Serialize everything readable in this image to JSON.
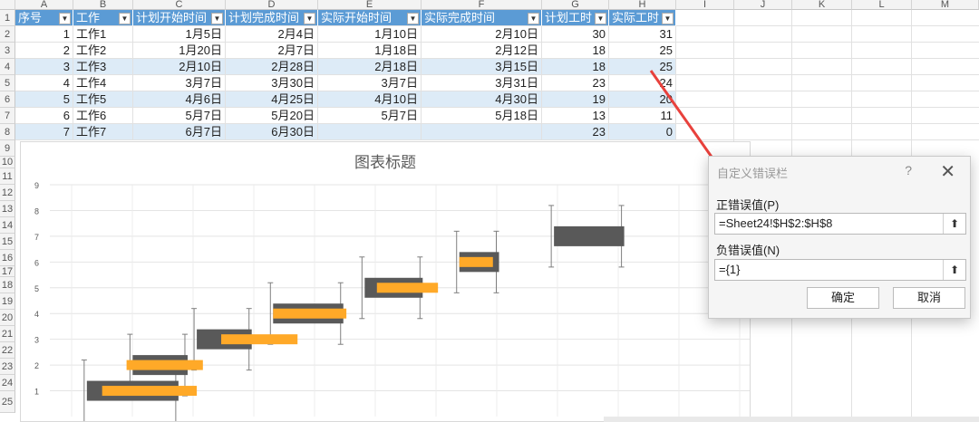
{
  "columns": [
    "A",
    "B",
    "C",
    "D",
    "E",
    "F",
    "G",
    "H",
    "I",
    "J",
    "K",
    "L",
    "M"
  ],
  "rows": [
    "1",
    "2",
    "3",
    "4",
    "5",
    "6",
    "7",
    "8",
    "9",
    "10",
    "11",
    "12",
    "13",
    "14",
    "15",
    "16",
    "17",
    "18",
    "19",
    "20",
    "21",
    "22",
    "23",
    "24",
    "25"
  ],
  "table": {
    "headers": [
      "序号",
      "工作",
      "计划开始时间",
      "计划完成时间",
      "实际开始时间",
      "实际完成时间",
      "计划工时",
      "实际工时"
    ],
    "rows": [
      [
        "1",
        "工作1",
        "1月5日",
        "2月4日",
        "1月10日",
        "2月10日",
        "30",
        "31"
      ],
      [
        "2",
        "工作2",
        "1月20日",
        "2月7日",
        "1月18日",
        "2月12日",
        "18",
        "25"
      ],
      [
        "3",
        "工作3",
        "2月10日",
        "2月28日",
        "2月18日",
        "3月15日",
        "18",
        "25"
      ],
      [
        "4",
        "工作4",
        "3月7日",
        "3月30日",
        "3月7日",
        "3月31日",
        "23",
        "24"
      ],
      [
        "5",
        "工作5",
        "4月6日",
        "4月25日",
        "4月10日",
        "4月30日",
        "19",
        "20"
      ],
      [
        "6",
        "工作6",
        "5月7日",
        "5月20日",
        "5月7日",
        "5月18日",
        "13",
        "11"
      ],
      [
        "7",
        "工作7",
        "6月7日",
        "6月30日",
        "",
        "",
        "23",
        "0"
      ]
    ]
  },
  "chart": {
    "title": "图表标题"
  },
  "chart_data": {
    "type": "bar",
    "title": "图表标题",
    "ylim": [
      0,
      9
    ],
    "yticks": [
      "1",
      "2",
      "3",
      "4",
      "5",
      "6",
      "7",
      "8",
      "9"
    ],
    "series": [
      {
        "values": [
          {
            "y": 1,
            "start": "1月5日",
            "end": "2月4日"
          },
          {
            "y": 2,
            "start": "1月20日",
            "end": "2月7日"
          },
          {
            "y": 3,
            "start": "2月10日",
            "end": "2月28日"
          },
          {
            "y": 4,
            "start": "3月7日",
            "end": "3月30日"
          },
          {
            "y": 5,
            "start": "4月6日",
            "end": "4月25日"
          },
          {
            "y": 6,
            "start": "5月7日",
            "end": "5月20日"
          },
          {
            "y": 7,
            "start": "6月7日",
            "end": "6月30日"
          }
        ]
      },
      {
        "values": [
          {
            "y": 1,
            "start": "1月10日",
            "end": "2月10日"
          },
          {
            "y": 2,
            "start": "1月18日",
            "end": "2月12日"
          },
          {
            "y": 3,
            "start": "2月18日",
            "end": "3月15日"
          },
          {
            "y": 4,
            "start": "3月7日",
            "end": "3月31日"
          },
          {
            "y": 5,
            "start": "4月10日",
            "end": "4月30日"
          },
          {
            "y": 6,
            "start": "5月7日",
            "end": "5月18日"
          }
        ]
      }
    ],
    "grid": true,
    "colors": {
      "plan": "#595959",
      "actual": "#ffa928",
      "errbar": "#7f7f7f"
    }
  },
  "dialog": {
    "title": "自定义错误栏",
    "help": "?",
    "close": "✕",
    "positive_label": "正错误值(P)",
    "positive_value": "=Sheet24!$H$2:$H$8",
    "negative_label": "负错误值(N)",
    "negative_value": "={1}",
    "ok": "确定",
    "cancel": "取消"
  },
  "annotation": {
    "arrow_color": "#e8413c"
  }
}
